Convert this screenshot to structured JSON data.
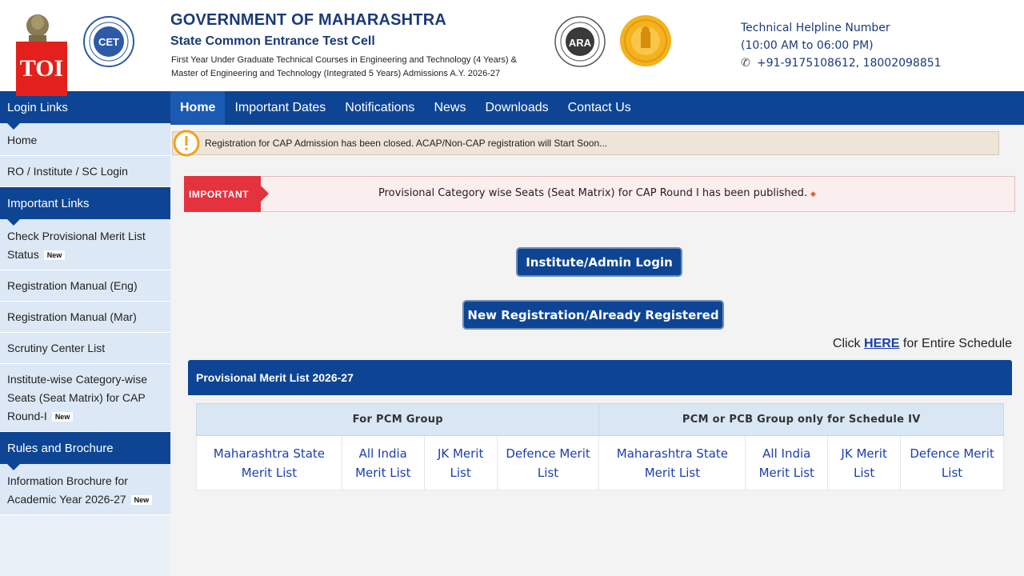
{
  "header": {
    "toi_label": "TOI",
    "gov_title": "GOVERNMENT OF MAHARASHTRA",
    "cell_title": "State Common Entrance Test Cell",
    "courses_line1": "First Year Under Graduate Technical Courses in Engineering and Technology (4 Years) &",
    "courses_line2": "Master of Engineering and Technology (Integrated 5 Years) Admissions A.Y. 2026-27",
    "cet_logo_text": "CET",
    "ara_logo_text": "ARA",
    "helpline_title": "Technical Helpline Number",
    "helpline_hours": "(10:00 AM to 06:00 PM)",
    "helpline_numbers": "+91-9175108612, 18002098851"
  },
  "sidebar": {
    "login_links_heading": "Login Links",
    "home": "Home",
    "ro_login": "RO / Institute / SC Login",
    "important_links_heading": "Important Links",
    "check_merit_line1": "Check Provisional Merit List",
    "check_merit_line2": "Status",
    "reg_manual_eng": "Registration Manual (Eng)",
    "reg_manual_mar": "Registration Manual (Mar)",
    "scrutiny_center": "Scrutiny Center List",
    "seat_matrix_line1": "Institute-wise Category-wise",
    "seat_matrix_line2": "Seats (Seat Matrix) for CAP",
    "seat_matrix_line3": "Round-I",
    "rules_heading": "Rules and Brochure",
    "brochure_line1": "Information Brochure for",
    "brochure_line2": "Academic Year 2026-27",
    "new_tag": "New"
  },
  "nav": {
    "items": [
      "Home",
      "Important Dates",
      "Notifications",
      "News",
      "Downloads",
      "Contact Us"
    ],
    "active": "Home"
  },
  "notice": {
    "text": "Registration for CAP Admission has been closed. ACAP/Non-CAP registration will Start Soon..."
  },
  "important": {
    "tag": "IMPORTANT",
    "text": "Provisional Category wise Seats (Seat Matrix) for CAP Round I has been published."
  },
  "buttons": {
    "admin_login": "Institute/Admin Login",
    "new_registration": "New Registration/Already Registered"
  },
  "schedule": {
    "prefix": "Click",
    "link": "HERE",
    "suffix": "for Entire Schedule"
  },
  "merit": {
    "panel_title": "Provisional Merit List 2026-27",
    "group_pcm": "For PCM Group",
    "group_pcb": "PCM or PCB Group only for Schedule IV",
    "cells": [
      [
        "Maharashtra State",
        "Merit List"
      ],
      [
        "All India",
        "Merit List"
      ],
      [
        "JK Merit",
        "List"
      ],
      [
        "Defence Merit",
        "List"
      ],
      [
        "Maharashtra State",
        "Merit List"
      ],
      [
        "All India",
        "Merit List"
      ],
      [
        "JK Merit",
        "List"
      ],
      [
        "Defence Merit",
        "List"
      ]
    ]
  },
  "colors": {
    "primary_blue": "#0d4594",
    "important_red": "#e5323f",
    "link_blue": "#1a3fae",
    "toi_red": "#e3201b"
  }
}
